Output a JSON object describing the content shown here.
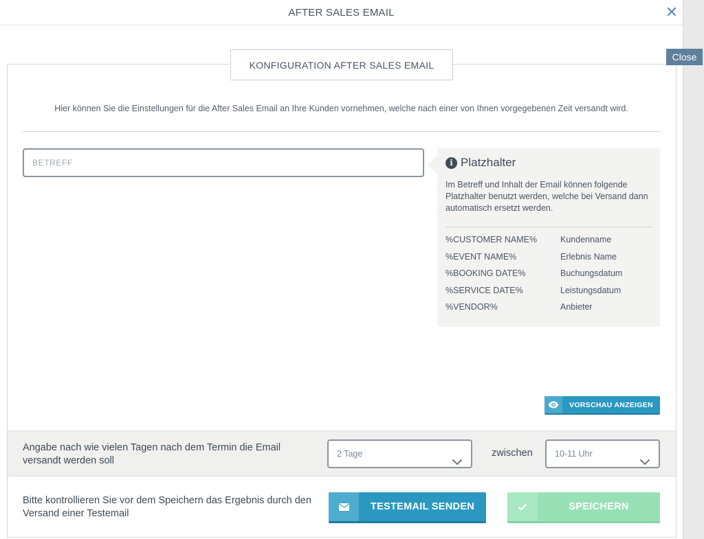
{
  "header": {
    "title": "AFTER SALES EMAIL",
    "close_symbol": "✕"
  },
  "close_tab": {
    "label": "Close"
  },
  "panel": {
    "legend": "KONFIGURATION AFTER SALES EMAIL",
    "intro": "Hier können Sie die Einstellungen für die After Sales Email an Ihre Kunden vornehmen, welche nach einer von Ihnen vorgegebenen Zeit versandt wird."
  },
  "subject": {
    "placeholder": "BETREFF",
    "value": ""
  },
  "placeholders": {
    "title": "Platzhalter",
    "description": "Im Betreff und Inhalt der Email können folgende Platzhalter benutzt werden, welche bei Versand dann automatisch ersetzt werden.",
    "items": [
      {
        "key": "%CUSTOMER NAME%",
        "value": "Kundenname"
      },
      {
        "key": "%EVENT NAME%",
        "value": "Erlebnis Name"
      },
      {
        "key": "%BOOKING DATE%",
        "value": "Buchungsdatum"
      },
      {
        "key": "%SERVICE DATE%",
        "value": "Leistungsdatum"
      },
      {
        "key": "%VENDOR%",
        "value": "Anbieter"
      }
    ]
  },
  "preview_button": {
    "label": "VORSCHAU ANZEIGEN"
  },
  "schedule": {
    "label": "Angabe nach wie vielen Tagen nach dem Termin die Email versandt werden soll",
    "days_selected": "2 Tage",
    "between_label": "zwischen",
    "time_selected": "10-11 Uhr"
  },
  "footer": {
    "note": "Bitte kontrollieren Sie vor dem Speichern das Ergebnis durch den Versand einer Testemail",
    "test_button": "TESTEMAIL SENDEN",
    "save_button": "SPEICHERN"
  },
  "colors": {
    "primary": "#2a98c0",
    "success_disabled": "#98e0b6",
    "close_tab": "#5f7f9d"
  }
}
